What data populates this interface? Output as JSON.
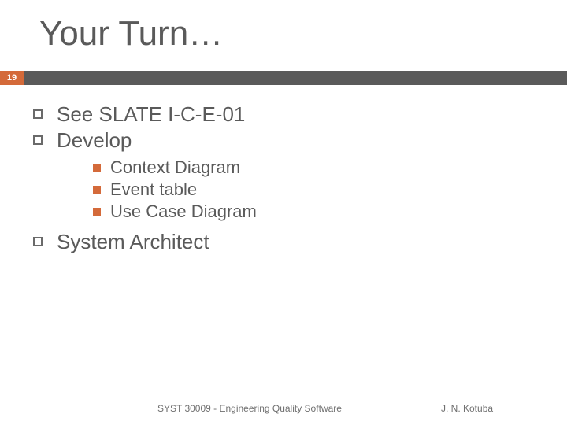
{
  "slide": {
    "title": "Your Turn…",
    "page_number": "19",
    "bullets": [
      {
        "text": "See SLATE I-C-E-01"
      },
      {
        "text": "Develop",
        "children": [
          {
            "text": "Context Diagram"
          },
          {
            "text": "Event table"
          },
          {
            "text": "Use Case Diagram"
          }
        ]
      },
      {
        "text": "System Architect"
      }
    ],
    "footer": {
      "course": "SYST 30009 - Engineering Quality Software",
      "author": "J. N. Kotuba"
    }
  }
}
